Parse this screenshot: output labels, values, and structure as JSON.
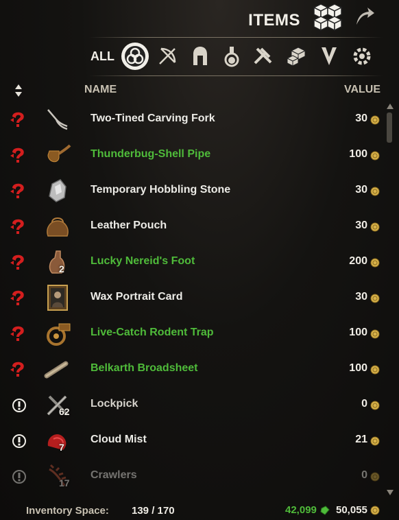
{
  "header": {
    "title": "ITEMS",
    "all_label": "ALL",
    "filters": [
      "all",
      "weapons",
      "armor",
      "consumables",
      "crafting",
      "furnishings",
      "misc",
      "junk"
    ]
  },
  "columns": {
    "name": "NAME",
    "value": "VALUE"
  },
  "items": [
    {
      "name": "Two-Tined Carving Fork",
      "value": "30",
      "qty": "",
      "quality": "normal",
      "status": "stolen",
      "icon": "fork-icon"
    },
    {
      "name": "Thunderbug-Shell Pipe",
      "value": "100",
      "qty": "",
      "quality": "fine",
      "status": "stolen",
      "icon": "pipe-icon"
    },
    {
      "name": "Temporary Hobbling Stone",
      "value": "30",
      "qty": "",
      "quality": "normal",
      "status": "stolen",
      "icon": "stone-icon"
    },
    {
      "name": "Leather Pouch",
      "value": "30",
      "qty": "",
      "quality": "normal",
      "status": "stolen",
      "icon": "pouch-icon"
    },
    {
      "name": "Lucky Nereid's Foot",
      "value": "200",
      "qty": "2",
      "quality": "fine",
      "status": "stolen",
      "icon": "foot-icon"
    },
    {
      "name": "Wax Portrait Card",
      "value": "30",
      "qty": "",
      "quality": "normal",
      "status": "stolen",
      "icon": "portrait-icon"
    },
    {
      "name": "Live-Catch Rodent Trap",
      "value": "100",
      "qty": "",
      "quality": "fine",
      "status": "stolen",
      "icon": "trap-icon"
    },
    {
      "name": "Belkarth Broadsheet",
      "value": "100",
      "qty": "",
      "quality": "fine",
      "status": "stolen",
      "icon": "scroll-icon"
    },
    {
      "name": "Lockpick",
      "value": "0",
      "qty": "62",
      "quality": "normal",
      "status": "quest",
      "icon": "lockpick-icon"
    },
    {
      "name": "Cloud Mist",
      "value": "21",
      "qty": "7",
      "quality": "normal",
      "status": "quest",
      "icon": "mist-icon"
    },
    {
      "name": "Crawlers",
      "value": "0",
      "qty": "17",
      "quality": "normal",
      "status": "quest",
      "icon": "crawlers-icon"
    }
  ],
  "footer": {
    "inventory_label": "Inventory Space:",
    "inventory_value": "139 / 170",
    "crowns": "42,099",
    "gold": "50,055"
  },
  "colors": {
    "fine_green": "#4fbb3a",
    "stolen_red": "#d41e1e",
    "gold_coin": "#d8b24a"
  }
}
